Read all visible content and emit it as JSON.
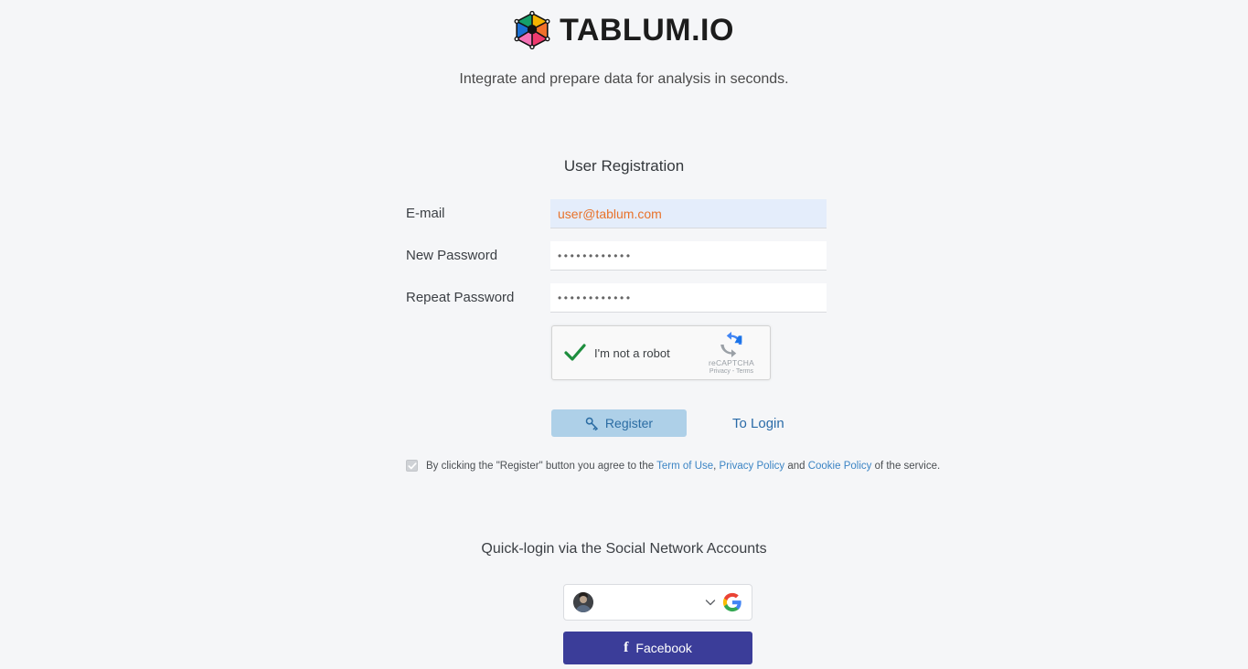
{
  "brand": {
    "name": "TABLUM.IO",
    "logo_icon": "hexagon-network-logo",
    "tagline": "Integrate and prepare data for analysis in seconds."
  },
  "form": {
    "title": "User Registration",
    "fields": [
      {
        "label": "E-mail",
        "value": "user@tablum.com",
        "placeholder": "",
        "type": "email",
        "autofilled": true
      },
      {
        "label": "New Password",
        "value": "••••••••••••",
        "placeholder": "",
        "type": "password",
        "autofilled": false
      },
      {
        "label": "Repeat Password",
        "value": "••••••••••••",
        "placeholder": "",
        "type": "password",
        "autofilled": false
      }
    ]
  },
  "recaptcha": {
    "label": "I'm not a robot",
    "checked": true,
    "brand": "reCAPTCHA",
    "privacy": "Privacy",
    "separator": "-",
    "terms": "Terms",
    "check_color": "#1e8e3e",
    "logo_icon": "recaptcha-logo"
  },
  "actions": {
    "register_label": "Register",
    "register_icon": "key-icon",
    "register_bg": "#aed0e8",
    "register_color": "#2b6ca3",
    "to_login_label": "To Login",
    "to_login_color": "#2a6ba8"
  },
  "terms": {
    "checkbox_checked": true,
    "checkbox_disabled": true,
    "prefix": "By clicking the \"Register\" button you agree to the ",
    "link_terms": "Term of Use",
    "sep1": ", ",
    "link_privacy": "Privacy Policy",
    "sep2": " and ",
    "link_cookie": "Cookie Policy",
    "suffix": " of the service.",
    "link_color": "#3b84c4"
  },
  "social": {
    "title": "Quick-login via the Social Network Accounts",
    "google": {
      "account_name_redacted": "",
      "account_email_redacted": "",
      "avatar_icon": "user-avatar",
      "chevron_icon": "chevron-down-icon",
      "logo_icon": "google-g-icon"
    },
    "facebook": {
      "label": "Facebook",
      "icon": "facebook-f-icon",
      "bg": "#3b3d99"
    }
  },
  "theme": {
    "page_bg": "#f5f6f8",
    "autofill_bg": "#e4edfb",
    "autofill_text": "#e8722a"
  }
}
